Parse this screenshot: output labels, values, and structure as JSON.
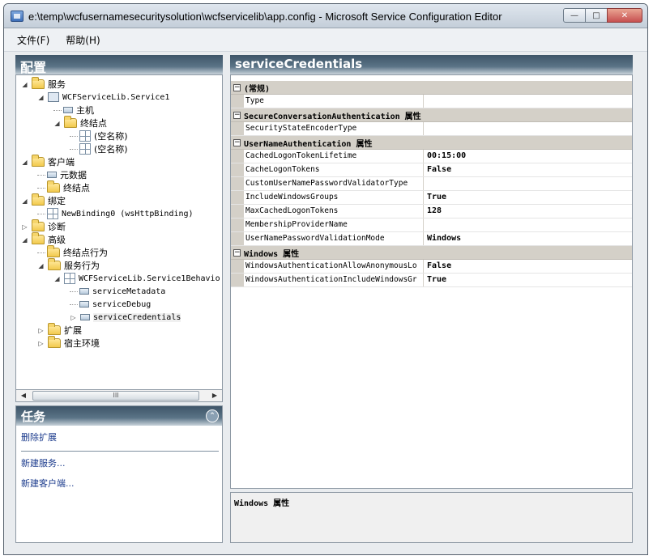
{
  "window": {
    "title": "e:\\temp\\wcfusernamesecuritysolution\\wcfservicelib\\app.config - Microsoft Service Configuration Editor"
  },
  "menu": {
    "file": "文件(F)",
    "help": "帮助(H)"
  },
  "left_pane": {
    "header": "配置",
    "tree": [
      {
        "label": "服务"
      },
      {
        "label": "WCFServiceLib.Service1"
      },
      {
        "label": "主机"
      },
      {
        "label": "终结点"
      },
      {
        "label": "(空名称)"
      },
      {
        "label": "(空名称)"
      },
      {
        "label": "客户端"
      },
      {
        "label": "元数据"
      },
      {
        "label": "终结点"
      },
      {
        "label": "绑定"
      },
      {
        "label": "NewBinding0 (wsHttpBinding)"
      },
      {
        "label": "诊断"
      },
      {
        "label": "高级"
      },
      {
        "label": "终结点行为"
      },
      {
        "label": "服务行为"
      },
      {
        "label": "WCFServiceLib.Service1Behavio"
      },
      {
        "label": "serviceMetadata"
      },
      {
        "label": "serviceDebug"
      },
      {
        "label": "serviceCredentials"
      },
      {
        "label": "扩展"
      },
      {
        "label": "宿主环境"
      }
    ],
    "scroll_label": "III"
  },
  "tasks": {
    "header": "任务",
    "links": [
      "删除扩展",
      "新建服务...",
      "新建客户端..."
    ]
  },
  "right_pane": {
    "header": "serviceCredentials",
    "categories": [
      {
        "name": "(常规)",
        "rows": [
          {
            "name": "Type",
            "value": ""
          }
        ]
      },
      {
        "name": "SecureConversationAuthentication 属性",
        "rows": [
          {
            "name": "SecurityStateEncoderType",
            "value": ""
          }
        ]
      },
      {
        "name": "UserNameAuthentication 属性",
        "rows": [
          {
            "name": "CachedLogonTokenLifetime",
            "value": "00:15:00"
          },
          {
            "name": "CacheLogonTokens",
            "value": "False"
          },
          {
            "name": "CustomUserNamePasswordValidatorType",
            "value": ""
          },
          {
            "name": "IncludeWindowsGroups",
            "value": "True"
          },
          {
            "name": "MaxCachedLogonTokens",
            "value": "128"
          },
          {
            "name": "MembershipProviderName",
            "value": ""
          },
          {
            "name": "UserNamePasswordValidationMode",
            "value": "Windows"
          }
        ]
      },
      {
        "name": "Windows 属性",
        "rows": [
          {
            "name": "WindowsAuthenticationAllowAnonymousLo",
            "value": "False"
          },
          {
            "name": "WindowsAuthenticationIncludeWindowsGr",
            "value": "True"
          }
        ]
      }
    ],
    "description": "Windows 属性"
  }
}
